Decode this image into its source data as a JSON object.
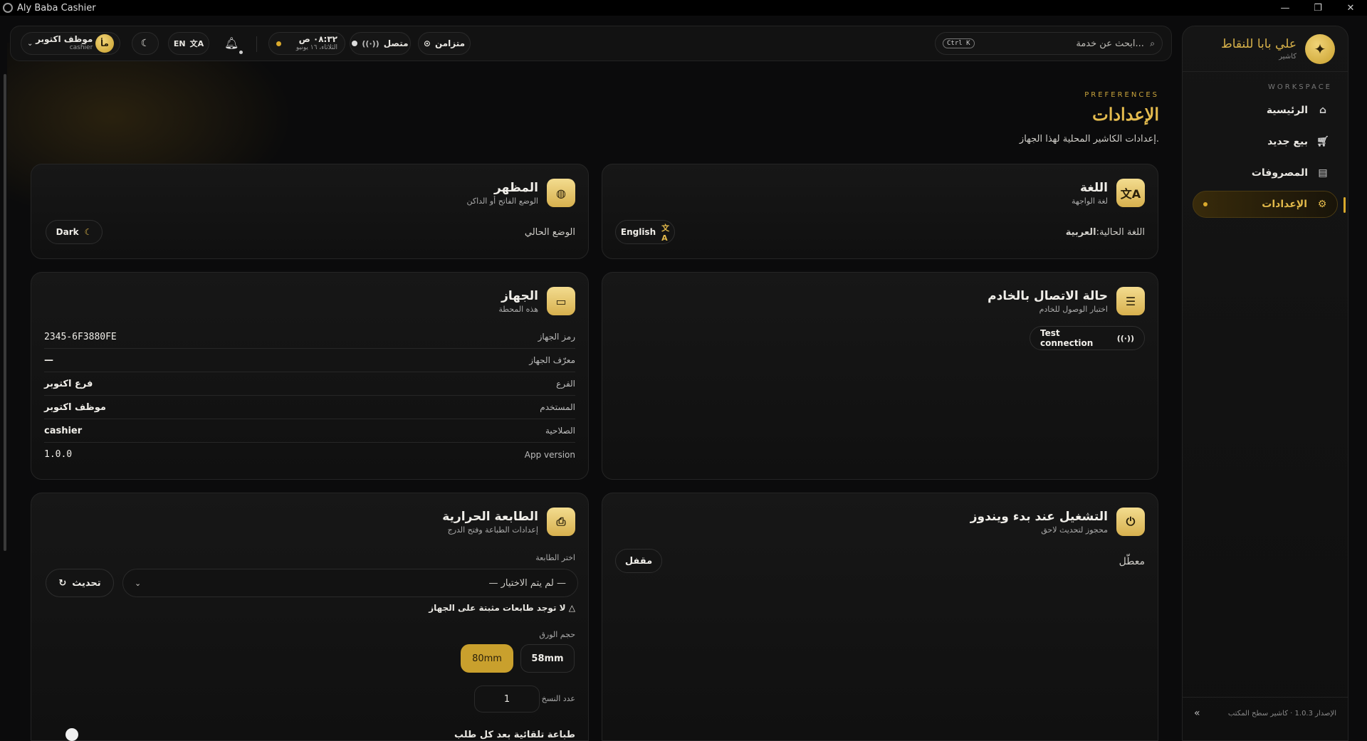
{
  "window": {
    "title": "Aly Baba Cashier",
    "controls": [
      "—",
      "❐",
      "✕"
    ]
  },
  "sidebar": {
    "brand_name": "علي بابا للنقاط",
    "brand_sub": "كاشير",
    "section_label": "WORKSPACE",
    "items": [
      {
        "label": "الرئيسية",
        "icon": "home-icon",
        "active": false
      },
      {
        "label": "بيع جديد",
        "icon": "cart-icon",
        "active": false
      },
      {
        "label": "المصروفات",
        "icon": "receipt-icon",
        "active": false
      },
      {
        "label": "الإعدادات",
        "icon": "gear-icon",
        "active": true
      }
    ],
    "footer_text": "الإصدار 1.0.3 · كاشير سطح المكتب",
    "collapse_icon": "«"
  },
  "header": {
    "search_placeholder": "ابحث عن خدمة...",
    "search_shortcut": "Ctrl K",
    "sync_label": "متزامن",
    "connection_label": "متصل",
    "time": "٠٨:٣٢ ص",
    "date": "الثلاثاء، ١٦ يونيو",
    "language_button": "EN",
    "user_name": "موظف اكتوبر",
    "user_role": "cashier",
    "avatar_initials": "مأ"
  },
  "page": {
    "pre_title": "PREFERENCES",
    "title": "الإعدادات",
    "subtitle": "إعدادات الكاشير المحلية لهذا الجهاز."
  },
  "cards": {
    "language": {
      "title": "اللغة",
      "subtitle": "لغة الواجهة",
      "current_label": "اللغة الحالية:",
      "current_value": "العربية",
      "button": "English"
    },
    "appearance": {
      "title": "المظهر",
      "subtitle": "الوضع الفاتح أو الداكن",
      "current_label": "الوضع الحالي",
      "button": "Dark"
    },
    "server": {
      "title": "حالة الاتصال بالخادم",
      "subtitle": "اختبار الوصول للخادم",
      "button": "Test connection"
    },
    "device": {
      "title": "الجهاز",
      "subtitle": "هذه المحطة",
      "rows": [
        {
          "label": "رمز الجهاز",
          "value": "2345-6F3880FE"
        },
        {
          "label": "معرّف الجهاز",
          "value": "—"
        },
        {
          "label": "الفرع",
          "value": "فرع اكتوبر"
        },
        {
          "label": "المستخدم",
          "value": "موظف اكتوبر"
        },
        {
          "label": "الصلاحية",
          "value": "cashier"
        },
        {
          "label": "App version",
          "value": "1.0.0"
        }
      ]
    },
    "startup": {
      "title": "التشغيل عند بدء ويندوز",
      "subtitle": "محجوز لتحديث لاحق",
      "status_label": "معطّل",
      "button": "مقفل"
    },
    "printer": {
      "title": "الطابعة الحرارية",
      "subtitle": "إعدادات الطباعة وفتح الدرج",
      "select_label": "اختر الطابعة",
      "select_value": "— لم يتم الاختيار —",
      "refresh_button": "تحديث",
      "warning": "لا توجد طابعات مثبتة على الجهاز",
      "paper_label": "حجم الورق",
      "paper_options": [
        "58mm",
        "80mm"
      ],
      "paper_selected": "80mm",
      "copies_label": "عدد النسخ",
      "copies_value": "1",
      "auto_print_label": "طباعة تلقائية بعد كل طلب"
    }
  },
  "colors": {
    "accent": "#d9a92c",
    "background": "#0b0b0c",
    "card": "#151515"
  }
}
